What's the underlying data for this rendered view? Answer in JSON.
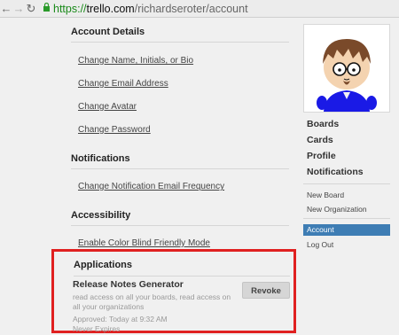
{
  "browser": {
    "url_scheme": "https://",
    "url_host": "trello.com",
    "url_path": "/richardseroter/account",
    "back_icon": "arrow-left-icon",
    "forward_icon": "arrow-right-icon",
    "reload_icon": "reload-icon",
    "lock_icon": "lock-icon"
  },
  "account_details": {
    "heading": "Account Details",
    "links": [
      "Change Name, Initials, or Bio",
      "Change Email Address",
      "Change Avatar",
      "Change Password"
    ]
  },
  "notifications": {
    "heading": "Notifications",
    "links": [
      "Change Notification Email Frequency"
    ]
  },
  "accessibility": {
    "heading": "Accessibility",
    "links": [
      "Enable Color Blind Friendly Mode"
    ]
  },
  "applications": {
    "heading": "Applications",
    "app_name": "Release Notes Generator",
    "description": "read access on all your boards, read access on all your organizations",
    "approved": "Approved: Today at 9:32 AM",
    "expires": "Never Expires",
    "revoke_label": "Revoke",
    "highlight_color": "#e02020"
  },
  "sidebar": {
    "main_items": [
      "Boards",
      "Cards",
      "Profile",
      "Notifications"
    ],
    "create_items": [
      "New Board",
      "New Organization"
    ],
    "active_item": "Account",
    "logout": "Log Out",
    "active_color": "#3e7db4"
  }
}
